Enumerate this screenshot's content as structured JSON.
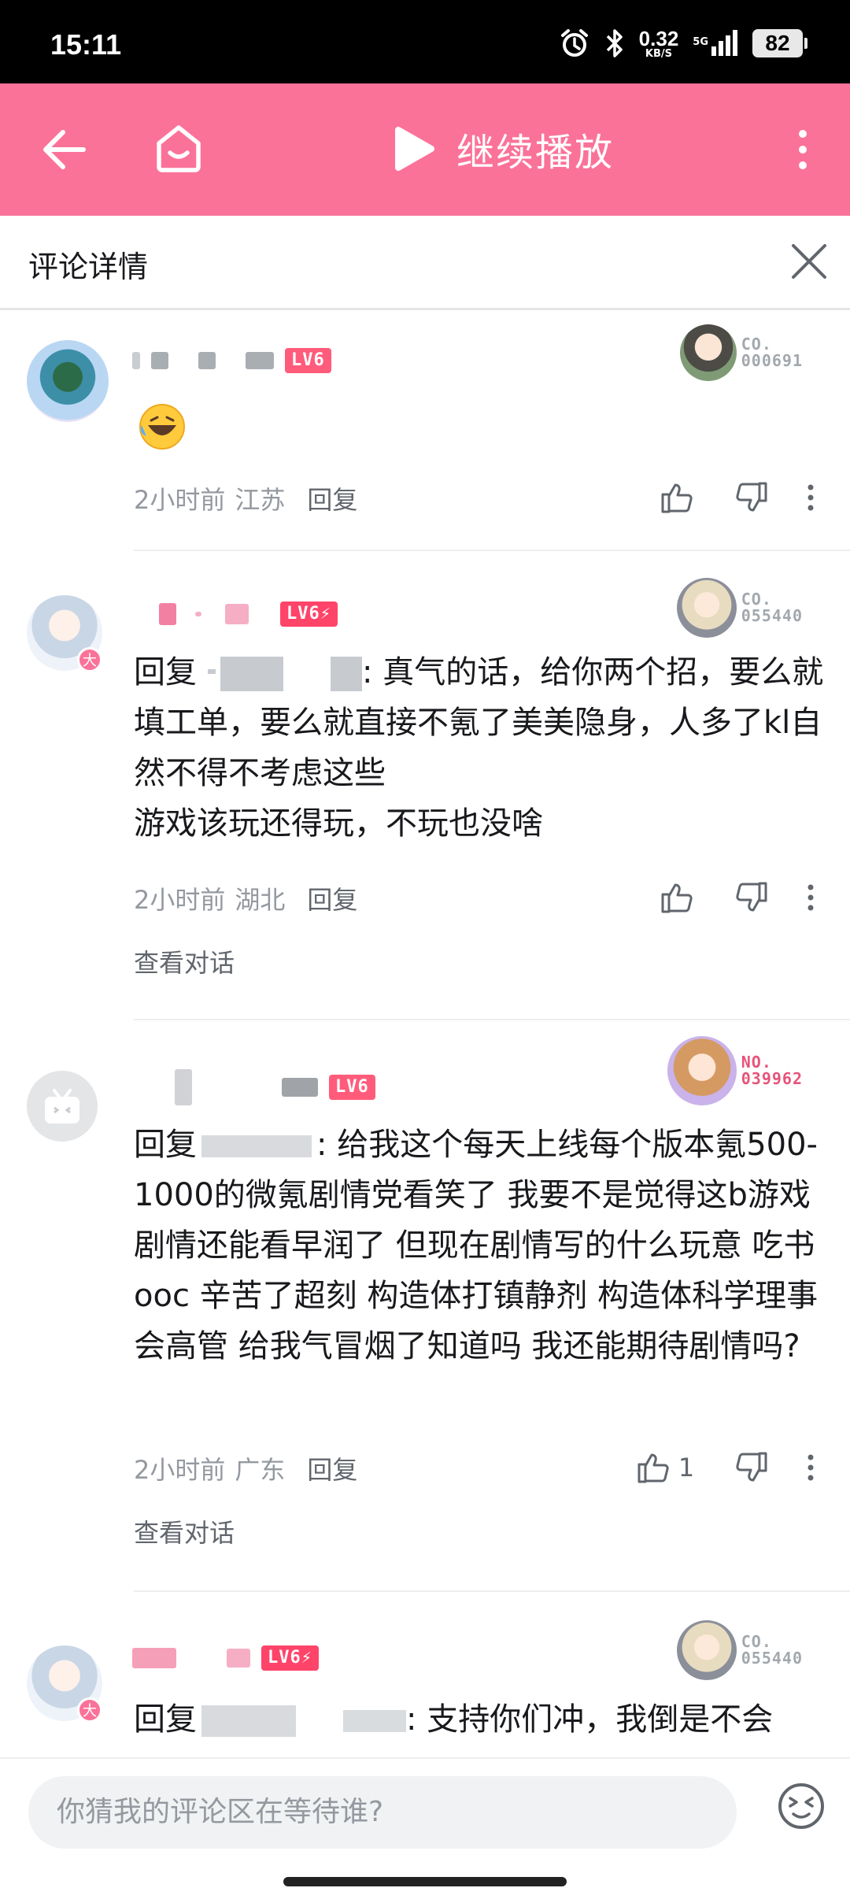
{
  "status_bar": {
    "time": "15:11",
    "net_speed": "0.32",
    "net_speed_unit": "KB/S",
    "net_type": "5G",
    "battery": "82"
  },
  "header": {
    "continue_label": "继续播放",
    "bg_color": "#fb7299"
  },
  "panel": {
    "title": "评论详情"
  },
  "comments": [
    {
      "level": "LV6",
      "fan_no": [
        "CO.",
        "000691"
      ],
      "content": "",
      "has_emoji": true,
      "time": "2小时前",
      "location": "江苏",
      "reply_label": "回复",
      "likes": ""
    },
    {
      "level": "LV6⚡",
      "fan_no": [
        "CO.",
        "055440"
      ],
      "reply_prefix": "回复",
      "content": ": 真气的话，给你两个招，要么就填工单，要么就直接不氪了美美隐身，人多了kl自然不得不考虑这些",
      "content2": "游戏该玩还得玩，不玩也没啥",
      "time": "2小时前",
      "location": "湖北",
      "reply_label": "回复",
      "view_conversation": "查看对话",
      "likes": ""
    },
    {
      "level": "LV6",
      "fan_no": [
        "NO.",
        "039962"
      ],
      "reply_prefix": "回复",
      "content": ": 给我这个每天上线每个版本氪500-1000的微氪剧情党看笑了 我要不是觉得这b游戏剧情还能看早润了 但现在剧情写的什么玩意 吃书ooc 辛苦了超刻 构造体打镇静剂 构造体科学理事会高管 给我气冒烟了知道吗 我还能期待剧情吗?",
      "time": "2小时前",
      "location": "广东",
      "reply_label": "回复",
      "view_conversation": "查看对话",
      "likes": "1"
    },
    {
      "level": "LV6⚡",
      "fan_no": [
        "CO.",
        "055440"
      ],
      "reply_prefix": "回复",
      "content": ": 支持你们冲，我倒是不会"
    }
  ],
  "composer": {
    "placeholder": "你猜我的评论区在等待谁?"
  }
}
